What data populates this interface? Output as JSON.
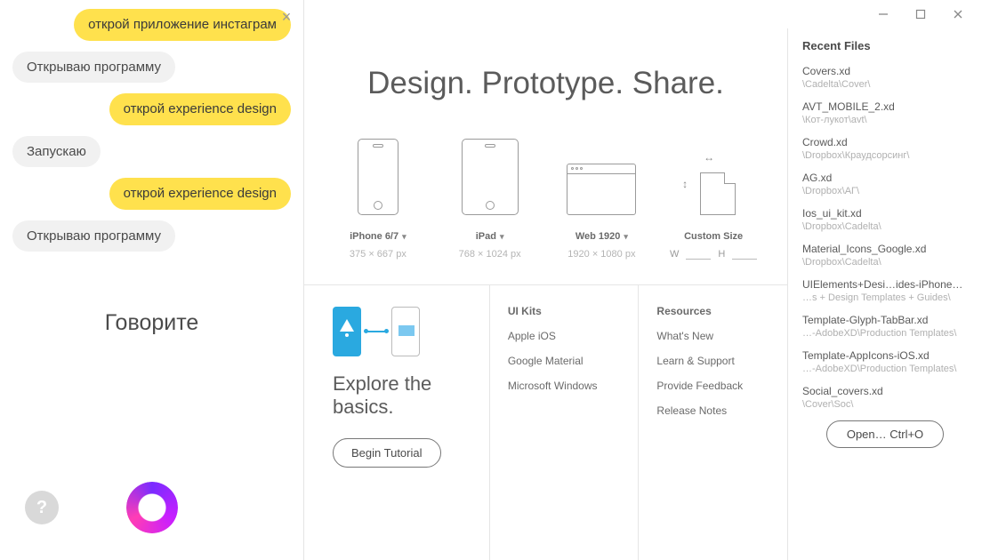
{
  "assistant": {
    "messages": [
      {
        "side": "right",
        "kind": "user",
        "text": "открой приложение инстаграм"
      },
      {
        "side": "left",
        "kind": "bot",
        "text": "Открываю программу"
      },
      {
        "side": "right",
        "kind": "user",
        "text": "открой experience design"
      },
      {
        "side": "left",
        "kind": "bot",
        "text": "Запускаю"
      },
      {
        "side": "right",
        "kind": "user",
        "text": "открой experience design"
      },
      {
        "side": "left",
        "kind": "bot",
        "text": "Открываю программу"
      }
    ],
    "speak_prompt": "Говорите",
    "help_label": "?"
  },
  "hero": "Design. Prototype. Share.",
  "presets": [
    {
      "name": "iPhone 6/7",
      "dims": "375 × 667 px"
    },
    {
      "name": "iPad",
      "dims": "768 × 1024 px"
    },
    {
      "name": "Web 1920",
      "dims": "1920 × 1080 px"
    },
    {
      "name": "Custom Size",
      "w_label": "W",
      "h_label": "H"
    }
  ],
  "explore": {
    "title": "Explore the basics.",
    "button": "Begin Tutorial"
  },
  "uikits": {
    "heading": "UI Kits",
    "links": [
      "Apple iOS",
      "Google Material",
      "Microsoft Windows"
    ]
  },
  "resources": {
    "heading": "Resources",
    "links": [
      "What's New",
      "Learn & Support",
      "Provide Feedback",
      "Release Notes"
    ]
  },
  "recent": {
    "heading": "Recent Files",
    "files": [
      {
        "name": "Covers.xd",
        "path": "\\Cadelta\\Cover\\"
      },
      {
        "name": "AVT_MOBILE_2.xd",
        "path": "\\Кот-лукот\\avt\\"
      },
      {
        "name": "Crowd.xd",
        "path": "\\Dropbox\\Краудсорсинг\\"
      },
      {
        "name": "AG.xd",
        "path": "\\Dropbox\\АГ\\"
      },
      {
        "name": "Ios_ui_kit.xd",
        "path": "\\Dropbox\\Cadelta\\"
      },
      {
        "name": "Material_Icons_Google.xd",
        "path": "\\Dropbox\\Cadelta\\"
      },
      {
        "name": "UIElements+Desi…ides-iPhoneX.xd",
        "path": "…s + Design Templates + Guides\\"
      },
      {
        "name": "Template-Glyph-TabBar.xd",
        "path": "…-AdobeXD\\Production Templates\\"
      },
      {
        "name": "Template-AppIcons-iOS.xd",
        "path": "…-AdobeXD\\Production Templates\\"
      },
      {
        "name": "Social_covers.xd",
        "path": "\\Cover\\Soc\\"
      }
    ],
    "open_label": "Open…   Ctrl+O"
  }
}
